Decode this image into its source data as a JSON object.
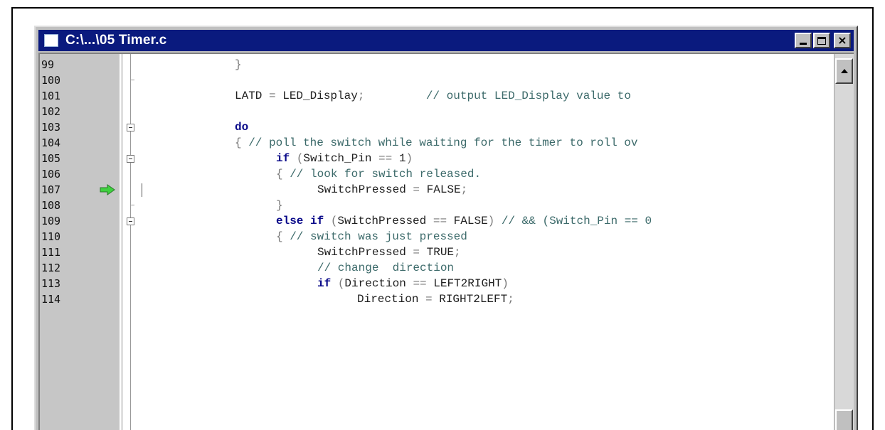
{
  "window": {
    "title": "C:\\...\\05 Timer.c",
    "buttons": {
      "minimize": "minimize-icon",
      "maximize": "maximize-icon",
      "close": "×"
    }
  },
  "editor": {
    "current_line": "107",
    "lines": [
      {
        "num": "99",
        "segments": [
          {
            "t": "}",
            "c": "op"
          }
        ]
      },
      {
        "num": "100",
        "segments": []
      },
      {
        "num": "101",
        "segments": [
          {
            "t": "LATD ",
            "c": ""
          },
          {
            "t": "= ",
            "c": "op"
          },
          {
            "t": "LED_Display",
            "c": ""
          },
          {
            "t": ";",
            "c": "op"
          },
          {
            "t": "         // output LED_Display value to",
            "c": "cm"
          }
        ]
      },
      {
        "num": "102",
        "segments": []
      },
      {
        "num": "103",
        "segments": [
          {
            "t": "do",
            "c": "kw"
          }
        ]
      },
      {
        "num": "104",
        "segments": [
          {
            "t": "{ ",
            "c": "op"
          },
          {
            "t": "// poll the switch while waiting for the timer to roll ov",
            "c": "cm"
          }
        ]
      },
      {
        "num": "105",
        "segments": [
          {
            "t": "if ",
            "c": "kw"
          },
          {
            "t": "(",
            "c": "op"
          },
          {
            "t": "Switch_Pin ",
            "c": ""
          },
          {
            "t": "== ",
            "c": "op"
          },
          {
            "t": "1",
            "c": ""
          },
          {
            "t": ")",
            "c": "op"
          }
        ]
      },
      {
        "num": "106",
        "segments": [
          {
            "t": "{ ",
            "c": "op"
          },
          {
            "t": "// look for switch released.",
            "c": "cm"
          }
        ]
      },
      {
        "num": "107",
        "segments": [
          {
            "t": "SwitchPressed ",
            "c": ""
          },
          {
            "t": "= ",
            "c": "op"
          },
          {
            "t": "FALSE",
            "c": ""
          },
          {
            "t": ";",
            "c": "op"
          }
        ]
      },
      {
        "num": "108",
        "segments": [
          {
            "t": "}",
            "c": "op"
          }
        ]
      },
      {
        "num": "109",
        "segments": [
          {
            "t": "else if ",
            "c": "kw"
          },
          {
            "t": "(",
            "c": "op"
          },
          {
            "t": "SwitchPressed ",
            "c": ""
          },
          {
            "t": "== ",
            "c": "op"
          },
          {
            "t": "FALSE",
            "c": ""
          },
          {
            "t": ") ",
            "c": "op"
          },
          {
            "t": "// && (Switch_Pin == 0",
            "c": "cm"
          }
        ]
      },
      {
        "num": "110",
        "segments": [
          {
            "t": "{ ",
            "c": "op"
          },
          {
            "t": "// switch was just pressed",
            "c": "cm"
          }
        ]
      },
      {
        "num": "111",
        "segments": [
          {
            "t": "SwitchPressed ",
            "c": ""
          },
          {
            "t": "= ",
            "c": "op"
          },
          {
            "t": "TRUE",
            "c": ""
          },
          {
            "t": ";",
            "c": "op"
          }
        ]
      },
      {
        "num": "112",
        "segments": [
          {
            "t": "// change  direction",
            "c": "cm"
          }
        ]
      },
      {
        "num": "113",
        "segments": [
          {
            "t": "if ",
            "c": "kw"
          },
          {
            "t": "(",
            "c": "op"
          },
          {
            "t": "Direction ",
            "c": ""
          },
          {
            "t": "== ",
            "c": "op"
          },
          {
            "t": "LEFT2RIGHT",
            "c": ""
          },
          {
            "t": ")",
            "c": "op"
          }
        ]
      },
      {
        "num": "114",
        "segments": [
          {
            "t": "Direction ",
            "c": ""
          },
          {
            "t": "= ",
            "c": "op"
          },
          {
            "t": "RIGHT2LEFT",
            "c": ""
          },
          {
            "t": ";",
            "c": "op"
          }
        ]
      }
    ]
  },
  "colors": {
    "titlebar": "#0a1a7e",
    "gutter": "#c6c6c6",
    "keyword": "#0a0a8a",
    "comment": "#3c6a6a",
    "exec_arrow": "#3fd13f"
  }
}
